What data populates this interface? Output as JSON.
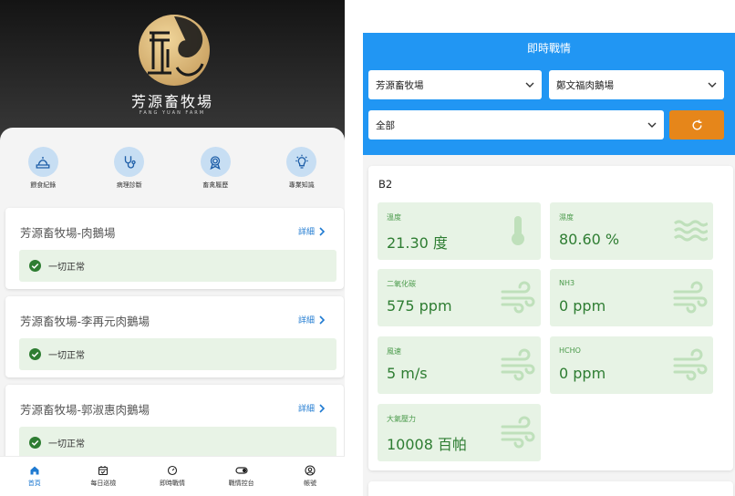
{
  "colors": {
    "primary": "#2196f3",
    "accent": "#e6861a",
    "success": "#2e7d32",
    "tile_bg": "#e7f3e5",
    "link": "#1f7ad1"
  },
  "left_app": {
    "brand": {
      "name": "芳源畜牧場",
      "subtitle": "FANG YUAN FARM",
      "logo_icon": "fang-yuan-logo"
    },
    "quick_actions": [
      {
        "label": "餵食紀錄",
        "icon": "feeding-icon"
      },
      {
        "label": "病理診斷",
        "icon": "stethoscope-icon"
      },
      {
        "label": "畜禽履歷",
        "icon": "certificate-icon"
      },
      {
        "label": "專業知識",
        "icon": "lightbulb-icon"
      }
    ],
    "farms": [
      {
        "name": "芳源畜牧場-肉鵝場",
        "detail": "詳細",
        "status": "一切正常"
      },
      {
        "name": "芳源畜牧場-李再元肉鵝場",
        "detail": "詳細",
        "status": "一切正常"
      },
      {
        "name": "芳源畜牧場-郭淑惠肉鵝場",
        "detail": "詳細",
        "status": "一切正常"
      }
    ],
    "bottom_nav": [
      {
        "label": "首頁",
        "icon": "home-icon",
        "active": true
      },
      {
        "label": "每日巡檢",
        "icon": "calendar-check-icon",
        "active": false
      },
      {
        "label": "即時戰情",
        "icon": "gauge-icon",
        "active": false
      },
      {
        "label": "戰情控台",
        "icon": "toggle-icon",
        "active": false
      },
      {
        "label": "帳號",
        "icon": "account-icon",
        "active": false
      }
    ]
  },
  "right_app": {
    "title": "即時戰情",
    "farm_select": {
      "value": "芳源畜牧場"
    },
    "house_select": {
      "value": "鄭文福肉鵝場"
    },
    "area_select": {
      "value": "全部"
    },
    "refresh_icon": "refresh-icon",
    "sensor_group": {
      "title": "B2",
      "tiles": [
        {
          "label": "溫度",
          "value": "21.30 度",
          "icon": "thermometer-icon"
        },
        {
          "label": "濕度",
          "value": "80.60 %",
          "icon": "humidity-waves-icon"
        },
        {
          "label": "二氧化碳",
          "value": "575 ppm",
          "icon": "wind-icon"
        },
        {
          "label": "NH3",
          "value": "0 ppm",
          "icon": "wind-icon"
        },
        {
          "label": "風速",
          "value": "5 m/s",
          "icon": "wind-icon"
        },
        {
          "label": "HCHO",
          "value": "0 ppm",
          "icon": "wind-icon"
        },
        {
          "label": "大氣壓力",
          "value": "10008 百帕",
          "icon": "wind-icon"
        }
      ]
    }
  }
}
